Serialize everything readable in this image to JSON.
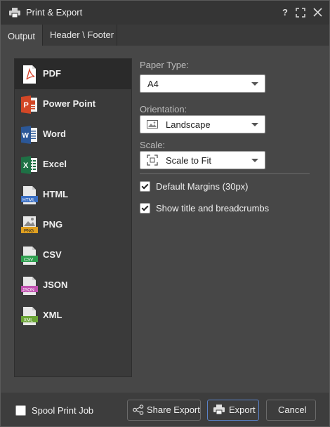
{
  "window": {
    "title": "Print & Export",
    "help": "?",
    "icons": [
      "printer-icon",
      "help-icon",
      "maximize-icon",
      "close-icon"
    ]
  },
  "tabs": [
    {
      "label": "Output"
    },
    {
      "label": "Header \\ Footer"
    }
  ],
  "formats": [
    {
      "label": "PDF",
      "icon": "pdf-icon",
      "color": "#d8442c"
    },
    {
      "label": "Power Point",
      "icon": "powerpoint-icon",
      "color": "#d24726"
    },
    {
      "label": "Word",
      "icon": "word-icon",
      "color": "#2b5797"
    },
    {
      "label": "Excel",
      "icon": "excel-icon",
      "color": "#1e7145"
    },
    {
      "label": "HTML",
      "icon": "html-icon",
      "tag": "HTML",
      "color": "#3a6fc4"
    },
    {
      "label": "PNG",
      "icon": "png-icon",
      "tag": "PNG",
      "color": "#e0a020"
    },
    {
      "label": "CSV",
      "icon": "csv-icon",
      "tag": "CSV",
      "color": "#2e9e4e"
    },
    {
      "label": "JSON",
      "icon": "json-icon",
      "tag": "JSON",
      "color": "#c052b0"
    },
    {
      "label": "XML",
      "icon": "xml-icon",
      "tag": "XML",
      "color": "#6aa436"
    }
  ],
  "settings": {
    "paper_type": {
      "label": "Paper Type:",
      "value": "A4"
    },
    "orientation": {
      "label": "Orientation:",
      "value": "Landscape",
      "icon": "image-icon"
    },
    "scale": {
      "label": "Scale:",
      "value": "Scale to Fit",
      "icon": "fit-screen-icon"
    },
    "default_margins": {
      "label": "Default Margins (30px)",
      "checked": true
    },
    "show_title": {
      "label": "Show title and breadcrumbs",
      "checked": true
    }
  },
  "footer": {
    "spool": {
      "label": "Spool Print Job",
      "checked": false
    },
    "share_export": {
      "label": "Share Export",
      "icon": "share-icon"
    },
    "export": {
      "label": "Export",
      "icon": "printer-icon"
    },
    "cancel": {
      "label": "Cancel"
    }
  },
  "colors": {
    "accent_border": "#5a82c8",
    "selected_row": "#2a2a2a"
  }
}
